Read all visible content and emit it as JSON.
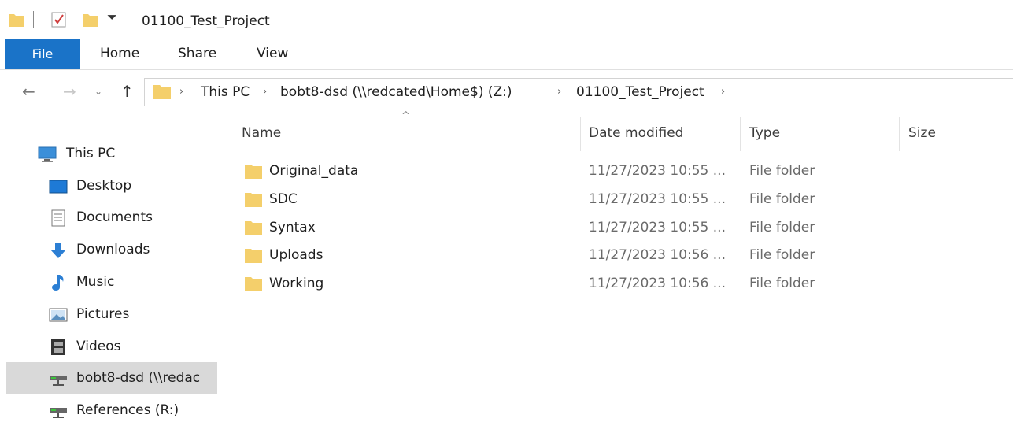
{
  "window": {
    "title": "01100_Test_Project"
  },
  "ribbon": {
    "tabs": [
      "File",
      "Home",
      "Share",
      "View"
    ]
  },
  "address": {
    "crumbs": [
      "This PC",
      "bobt8-dsd  (\\\\redcated\\Home$) (Z:)",
      "01100_Test_Project"
    ]
  },
  "nav": {
    "items": [
      {
        "label": "This PC",
        "icon": "this-pc-icon"
      },
      {
        "label": "Desktop",
        "icon": "desktop-icon"
      },
      {
        "label": "Documents",
        "icon": "documents-icon"
      },
      {
        "label": "Downloads",
        "icon": "downloads-icon"
      },
      {
        "label": "Music",
        "icon": "music-icon"
      },
      {
        "label": "Pictures",
        "icon": "pictures-icon"
      },
      {
        "label": "Videos",
        "icon": "videos-icon"
      },
      {
        "label": "bobt8-dsd  (\\\\redac",
        "icon": "network-drive-icon"
      },
      {
        "label": "References (R:)",
        "icon": "network-drive-icon"
      }
    ]
  },
  "columns": {
    "name": "Name",
    "date": "Date modified",
    "type": "Type",
    "size": "Size"
  },
  "files": [
    {
      "name": "Original_data",
      "date": "11/27/2023 10:55 ...",
      "type": "File folder"
    },
    {
      "name": "SDC",
      "date": "11/27/2023 10:55 ...",
      "type": "File folder"
    },
    {
      "name": "Syntax",
      "date": "11/27/2023 10:55 ...",
      "type": "File folder"
    },
    {
      "name": "Uploads",
      "date": "11/27/2023 10:56 ...",
      "type": "File folder"
    },
    {
      "name": "Working",
      "date": "11/27/2023 10:56 ...",
      "type": "File folder"
    }
  ],
  "colors": {
    "accent": "#1a73c8",
    "folder": "#f4cf6b",
    "selected": "#d9d9d9"
  }
}
